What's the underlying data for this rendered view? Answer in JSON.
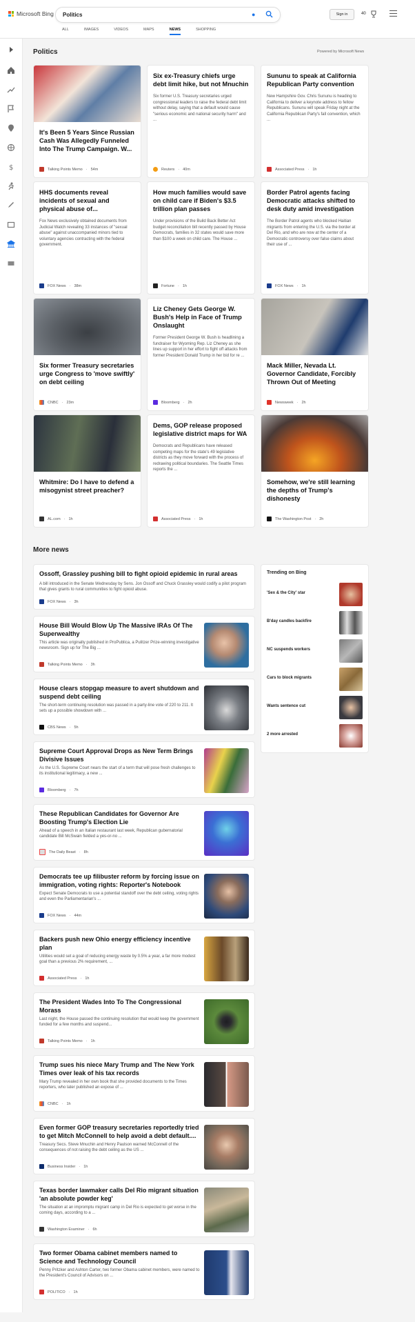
{
  "header": {
    "brand": "Microsoft Bing",
    "query": "Politics",
    "sign_in": "Sign in",
    "points": "40"
  },
  "tabs": [
    "ALL",
    "IMAGES",
    "VIDEOS",
    "MAPS",
    "NEWS",
    "SHOPPING"
  ],
  "page": {
    "title": "Politics",
    "powered": "Powered by Microsoft News",
    "more_news": "More news",
    "trending_title": "Trending on Bing"
  },
  "cards": [
    {
      "title": "It's Been 5 Years Since Russian Cash Was Allegedly Funneled Into The Trump Campaign. W...",
      "desc": "",
      "source": "Talking Points Memo",
      "time": "54m"
    },
    {
      "title": "Six ex-Treasury chiefs urge debt limit hike, but not Mnuchin",
      "desc": "Six former U.S. Treasury secretaries urged congressional leaders to raise the federal debt limit without delay, saying that a default would cause \"serious economic and national security harm\" and ...",
      "source": "Reuters",
      "time": "40m"
    },
    {
      "title": "Sununu to speak at California Republican Party convention",
      "desc": "New Hampshire Gov. Chris Sununu is heading to California to deliver a keynote address to fellow Republicans. Sununu will speak Friday night at the California Republican Party's fall convention, which ...",
      "source": "Associated Press",
      "time": "1h"
    },
    {
      "title": "HHS documents reveal incidents of sexual and physical abuse of...",
      "desc": "Fox News exclusively obtained documents from Judicial Watch revealing 33 instances of \"sexual abuse\" against unaccompanied minors tied to voluntary agencies contracting with the federal government.",
      "source": "FOX News",
      "time": "38m"
    },
    {
      "title": "How much families would save on child care if Biden's $3.5 trillion plan passes",
      "desc": "Under provisions of the Build Back Better Act budget reconciliation bill recently passed by House Democrats, families in 32 states would save more than $100 a week on child care. The House ...",
      "source": "Fortune",
      "time": "1h"
    },
    {
      "title": "Border Patrol agents facing Democratic attacks shifted to desk duty amid investigation",
      "desc": "The Border Patrol agents who blocked Haitian migrants from entering the U.S. via the border at Del Rio, and who are now at the center of a Democratic controversy over false claims about their use of ...",
      "source": "FOX News",
      "time": "1h"
    },
    {
      "title": "Six former Treasury secretaries urge Congress to 'move swiftly' on debt ceiling",
      "desc": "",
      "source": "CNBC",
      "time": "23m"
    },
    {
      "title": "Liz Cheney Gets George W. Bush's Help in Face of Trump Onslaught",
      "desc": "Former President George W. Bush is headlining a fundraiser for Wyoming Rep. Liz Cheney as she lines up support in her effort to fight off attacks from former President Donald Trump in her bid for re ...",
      "source": "Bloomberg",
      "time": "2h"
    },
    {
      "title": "Mack Miller, Nevada Lt. Governor Candidate, Forcibly Thrown Out of Meeting",
      "desc": "",
      "source": "Newsweek",
      "time": "2h"
    },
    {
      "title": "Whitmire: Do I have to defend a misogynist street preacher?",
      "desc": "",
      "source": "AL.com",
      "time": "1h"
    },
    {
      "title": "Dems, GOP release proposed legislative district maps for WA",
      "desc": "Democrats and Republicans have released competing maps for the state's 49 legislative districts as they move forward with the process of redrawing political boundaries. The Seattle Times reports the ...",
      "source": "Associated Press",
      "time": "1h"
    },
    {
      "title": "Somehow, we're still learning the depths of Trump's dishonesty",
      "desc": "",
      "source": "The Washington Post",
      "time": "2h"
    }
  ],
  "news": [
    {
      "title": "Ossoff, Grassley pushing bill to fight opioid epidemic in rural areas",
      "desc": "A bill introduced in the Senate Wednesday by Sens. Jon Ossoff and Chuck Grassley would codify a pilot program that gives grants to rural communities to fight opioid abuse.",
      "source": "FOX News",
      "time": "3h"
    },
    {
      "title": "House Bill Would Blow Up The Massive IRAs Of The Superwealthy",
      "desc": "This article was originally published in ProPublica, a Pulitzer Prize-winning investigative newsroom. Sign up for The Big ...",
      "source": "Talking Points Memo",
      "time": "3h"
    },
    {
      "title": "House clears stopgap measure to avert shutdown and suspend debt ceiling",
      "desc": "The short-term continuing resolution was passed in a party-line vote of 220 to 211. It sets up a possible showdown with ...",
      "source": "CBS News",
      "time": "5h"
    },
    {
      "title": "Supreme Court Approval Drops as New Term Brings Divisive Issues",
      "desc": "As the U.S. Supreme Court nears the start of a term that will pose fresh challenges to its institutional legitimacy, a new ...",
      "source": "Bloomberg",
      "time": "7h"
    },
    {
      "title": "These Republican Candidates for Governor Are Boosting Trump's Election Lie",
      "desc": "Ahead of a speech in an Italian restaurant last week, Republican gubernatorial candidate Bill McSwain fielded a yes-or-no ...",
      "source": "The Daily Beast",
      "time": "8h"
    },
    {
      "title": "Democrats tee up filibuster reform by forcing issue on immigration, voting rights: Reporter's Notebook",
      "desc": "Expect Senate Democrats to use a potential standoff over the debt ceiling, voting rights and even the Parliamentarian's ...",
      "source": "FOX News",
      "time": "44m"
    },
    {
      "title": "Backers push new Ohio energy efficiency incentive plan",
      "desc": "Utilities would set a goal of reducing energy waste by 0.5% a year, a far more modest goal than a previous 2% requirement, ...",
      "source": "Associated Press",
      "time": "1h"
    },
    {
      "title": "The President Wades Into To The Congressional Morass",
      "desc": "Last night, the House passed the continuing resolution that would keep the government funded for a few months and suspend...",
      "source": "Talking Points Memo",
      "time": "1h"
    },
    {
      "title": "Trump sues his niece Mary Trump and The New York Times over leak of his tax records",
      "desc": "Mary Trump revealed in her own book that she provided documents to the Times reporters, who later published an expose of ...",
      "source": "CNBC",
      "time": "1h"
    },
    {
      "title": "Even former GOP treasury secretaries reportedly tried to get Mitch McConnell to help avoid a debt default....",
      "desc": "Treasury Secs. Steve Mnuchin and Henry Paulson warned McConnell of the consequences of not raising the debt ceiling as the US ...",
      "source": "Business Insider",
      "time": "1h"
    },
    {
      "title": "Texas border lawmaker calls Del Rio migrant situation 'an absolute powder keg'",
      "desc": "The situation at an impromptu migrant camp in Del Rio is expected to get worse in the coming days, according to a ...",
      "source": "Washington Examiner",
      "time": "6h"
    },
    {
      "title": "Two former Obama cabinet members named to Science and Technology Council",
      "desc": "Penny Pritzker and Ashton Carter, two former Obama cabinet members, were named to the President's Council of Advisors on ...",
      "source": "POLITICO",
      "time": "1h"
    }
  ],
  "trending": [
    "'Sex & the City' star",
    "B'day candles backfire",
    "NC suspends workers",
    "Cars to block migrants",
    "Wants sentence cut",
    "2 more arrested"
  ]
}
